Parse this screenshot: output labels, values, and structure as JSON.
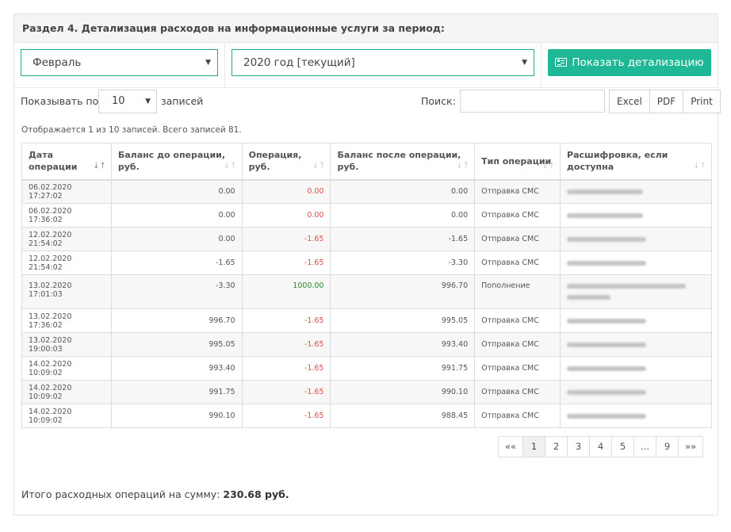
{
  "heading": "Раздел 4. Детализация расходов на информационные услуги за период:",
  "filters": {
    "month": "Февраль",
    "year": "2020 год [текущий]",
    "show_button": "Показать детализацию"
  },
  "table_controls": {
    "show_label": "Показывать по",
    "page_size": "10",
    "records_label": "записей",
    "search_label": "Поиск:",
    "search_value": "",
    "export_excel": "Excel",
    "export_pdf": "PDF",
    "export_print": "Print"
  },
  "info": "Отображается 1 из 10 записей. Всего записей 81.",
  "columns": [
    "Дата операции",
    "Баланс до операции, руб.",
    "Операция, руб.",
    "Баланс после операции, руб.",
    "Тип операции",
    "Расшифровка, если доступна"
  ],
  "rows": [
    {
      "date": "06.02.2020 17:27:02",
      "before": "0.00",
      "op": "0.00",
      "op_kind": "neg",
      "after": "0.00",
      "type": "Отправка СМС"
    },
    {
      "date": "06.02.2020 17:36:02",
      "before": "0.00",
      "op": "0.00",
      "op_kind": "neg",
      "after": "0.00",
      "type": "Отправка СМС"
    },
    {
      "date": "12.02.2020 21:54:02",
      "before": "0.00",
      "op": "-1.65",
      "op_kind": "neg",
      "after": "-1.65",
      "type": "Отправка СМС"
    },
    {
      "date": "12.02.2020 21:54:02",
      "before": "-1.65",
      "op": "-1.65",
      "op_kind": "neg",
      "after": "-3.30",
      "type": "Отправка СМС"
    },
    {
      "date": "13.02.2020 17:01:03",
      "before": "-3.30",
      "op": "1000.00",
      "op_kind": "pos",
      "after": "996.70",
      "type": "Пополнение"
    },
    {
      "date": "13.02.2020 17:36:02",
      "before": "996.70",
      "op": "-1.65",
      "op_kind": "neg",
      "after": "995.05",
      "type": "Отправка СМС"
    },
    {
      "date": "13.02.2020 19:00:03",
      "before": "995.05",
      "op": "-1.65",
      "op_kind": "neg",
      "after": "993.40",
      "type": "Отправка СМС"
    },
    {
      "date": "14.02.2020 10:09:02",
      "before": "993.40",
      "op": "-1.65",
      "op_kind": "neg",
      "after": "991.75",
      "type": "Отправка СМС"
    },
    {
      "date": "14.02.2020 10:09:02",
      "before": "991.75",
      "op": "-1.65",
      "op_kind": "neg",
      "after": "990.10",
      "type": "Отправка СМС"
    },
    {
      "date": "14.02.2020 10:09:02",
      "before": "990.10",
      "op": "-1.65",
      "op_kind": "neg",
      "after": "988.45",
      "type": "Отправка СМС"
    }
  ],
  "pagination": [
    "««",
    "1",
    "2",
    "3",
    "4",
    "5",
    "...",
    "9",
    "»»"
  ],
  "pagination_active": "1",
  "total_label": "Итого расходных операций на сумму:",
  "total_value": "230.68 руб.",
  "colors": {
    "accent": "#1fb896",
    "negative": "#d9534f",
    "positive": "#2d8a2d"
  }
}
